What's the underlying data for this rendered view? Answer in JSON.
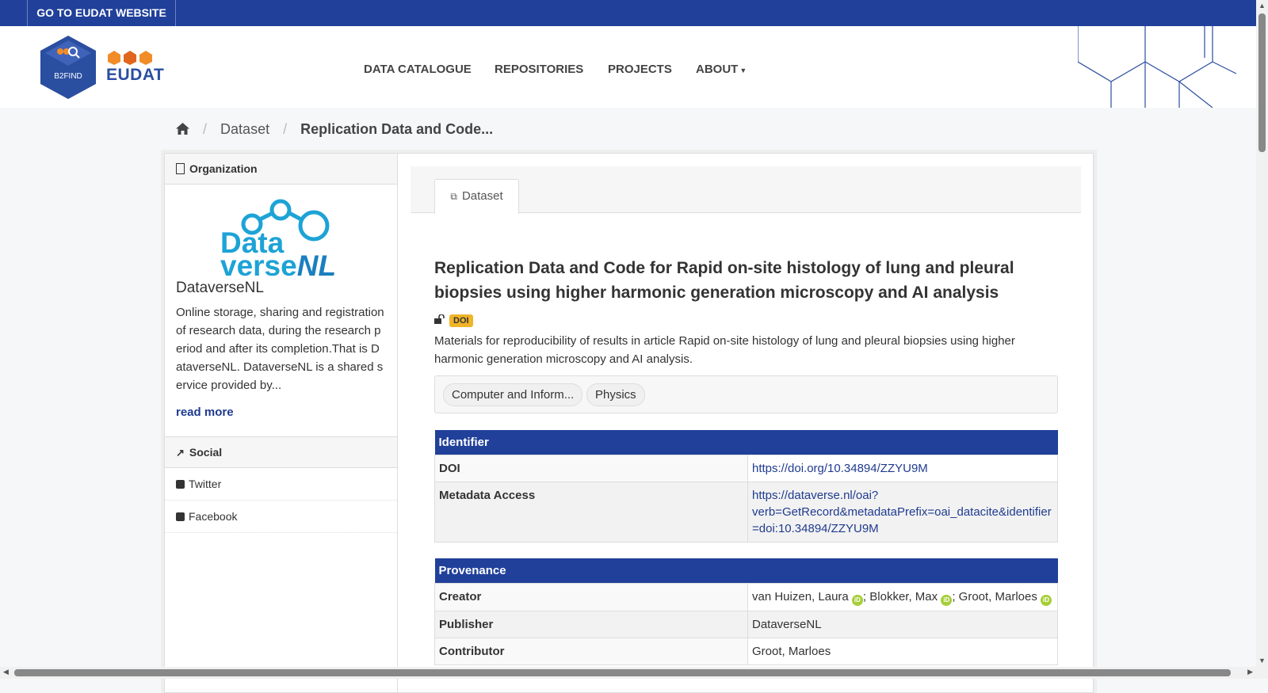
{
  "topbar": {
    "goto_label": "GO TO EUDAT WEBSITE"
  },
  "header": {
    "b2find_text": "B2FIND",
    "eudat_text": "EUDAT",
    "nav": [
      "DATA CATALOGUE",
      "REPOSITORIES",
      "PROJECTS",
      "ABOUT"
    ]
  },
  "breadcrumb": {
    "current": "Replication Data and Code...",
    "dataset": "Dataset"
  },
  "sidebar": {
    "org_heading": "Organization",
    "org_logo_line1": "Data",
    "org_logo_line2": "verse",
    "org_logo_line2_suffix": "NL",
    "org_name": "DataverseNL",
    "org_description": "Online storage, sharing and registration of research data, during the research period and after its completion.That is DataverseNL. DataverseNL is a shared service provided by...",
    "read_more": "read more",
    "social_heading": "Social",
    "social_items": [
      "Twitter",
      "Facebook"
    ]
  },
  "main": {
    "tab_label": "Dataset",
    "title": "Replication Data and Code for Rapid on-site histology of lung and pleural biopsies using higher harmonic generation microscopy and AI analysis",
    "doi_badge": "DOI",
    "notes": "Materials for reproducibility of results in article Rapid on-site histology of lung and pleural biopsies using higher harmonic generation microscopy and AI analysis.",
    "tags": [
      "Computer and Inform...",
      "Physics"
    ],
    "identifier": {
      "heading": "Identifier",
      "doi_label": "DOI",
      "doi_value": "https://doi.org/10.34894/ZZYU9M",
      "metadata_label": "Metadata Access",
      "metadata_value_1": "https://dataverse.nl/oai?",
      "metadata_value_2": "verb=GetRecord&metadataPrefix=oai_datacite&identifier",
      "metadata_value_3": "=doi:10.34894/ZZYU9M"
    },
    "provenance": {
      "heading": "Provenance",
      "creator_label": "Creator",
      "creators": [
        "van Huizen, Laura",
        "Blokker, Max",
        "Groot, Marloes"
      ],
      "publisher_label": "Publisher",
      "publisher_value": "DataverseNL",
      "contributor_label": "Contributor",
      "contributor_value": "Groot, Marloes"
    },
    "orcid_icon_text": "iD"
  },
  "colors": {
    "brand_blue": "#20409a",
    "doi_badge": "#f0b429",
    "orcid_green": "#a6ce39"
  }
}
